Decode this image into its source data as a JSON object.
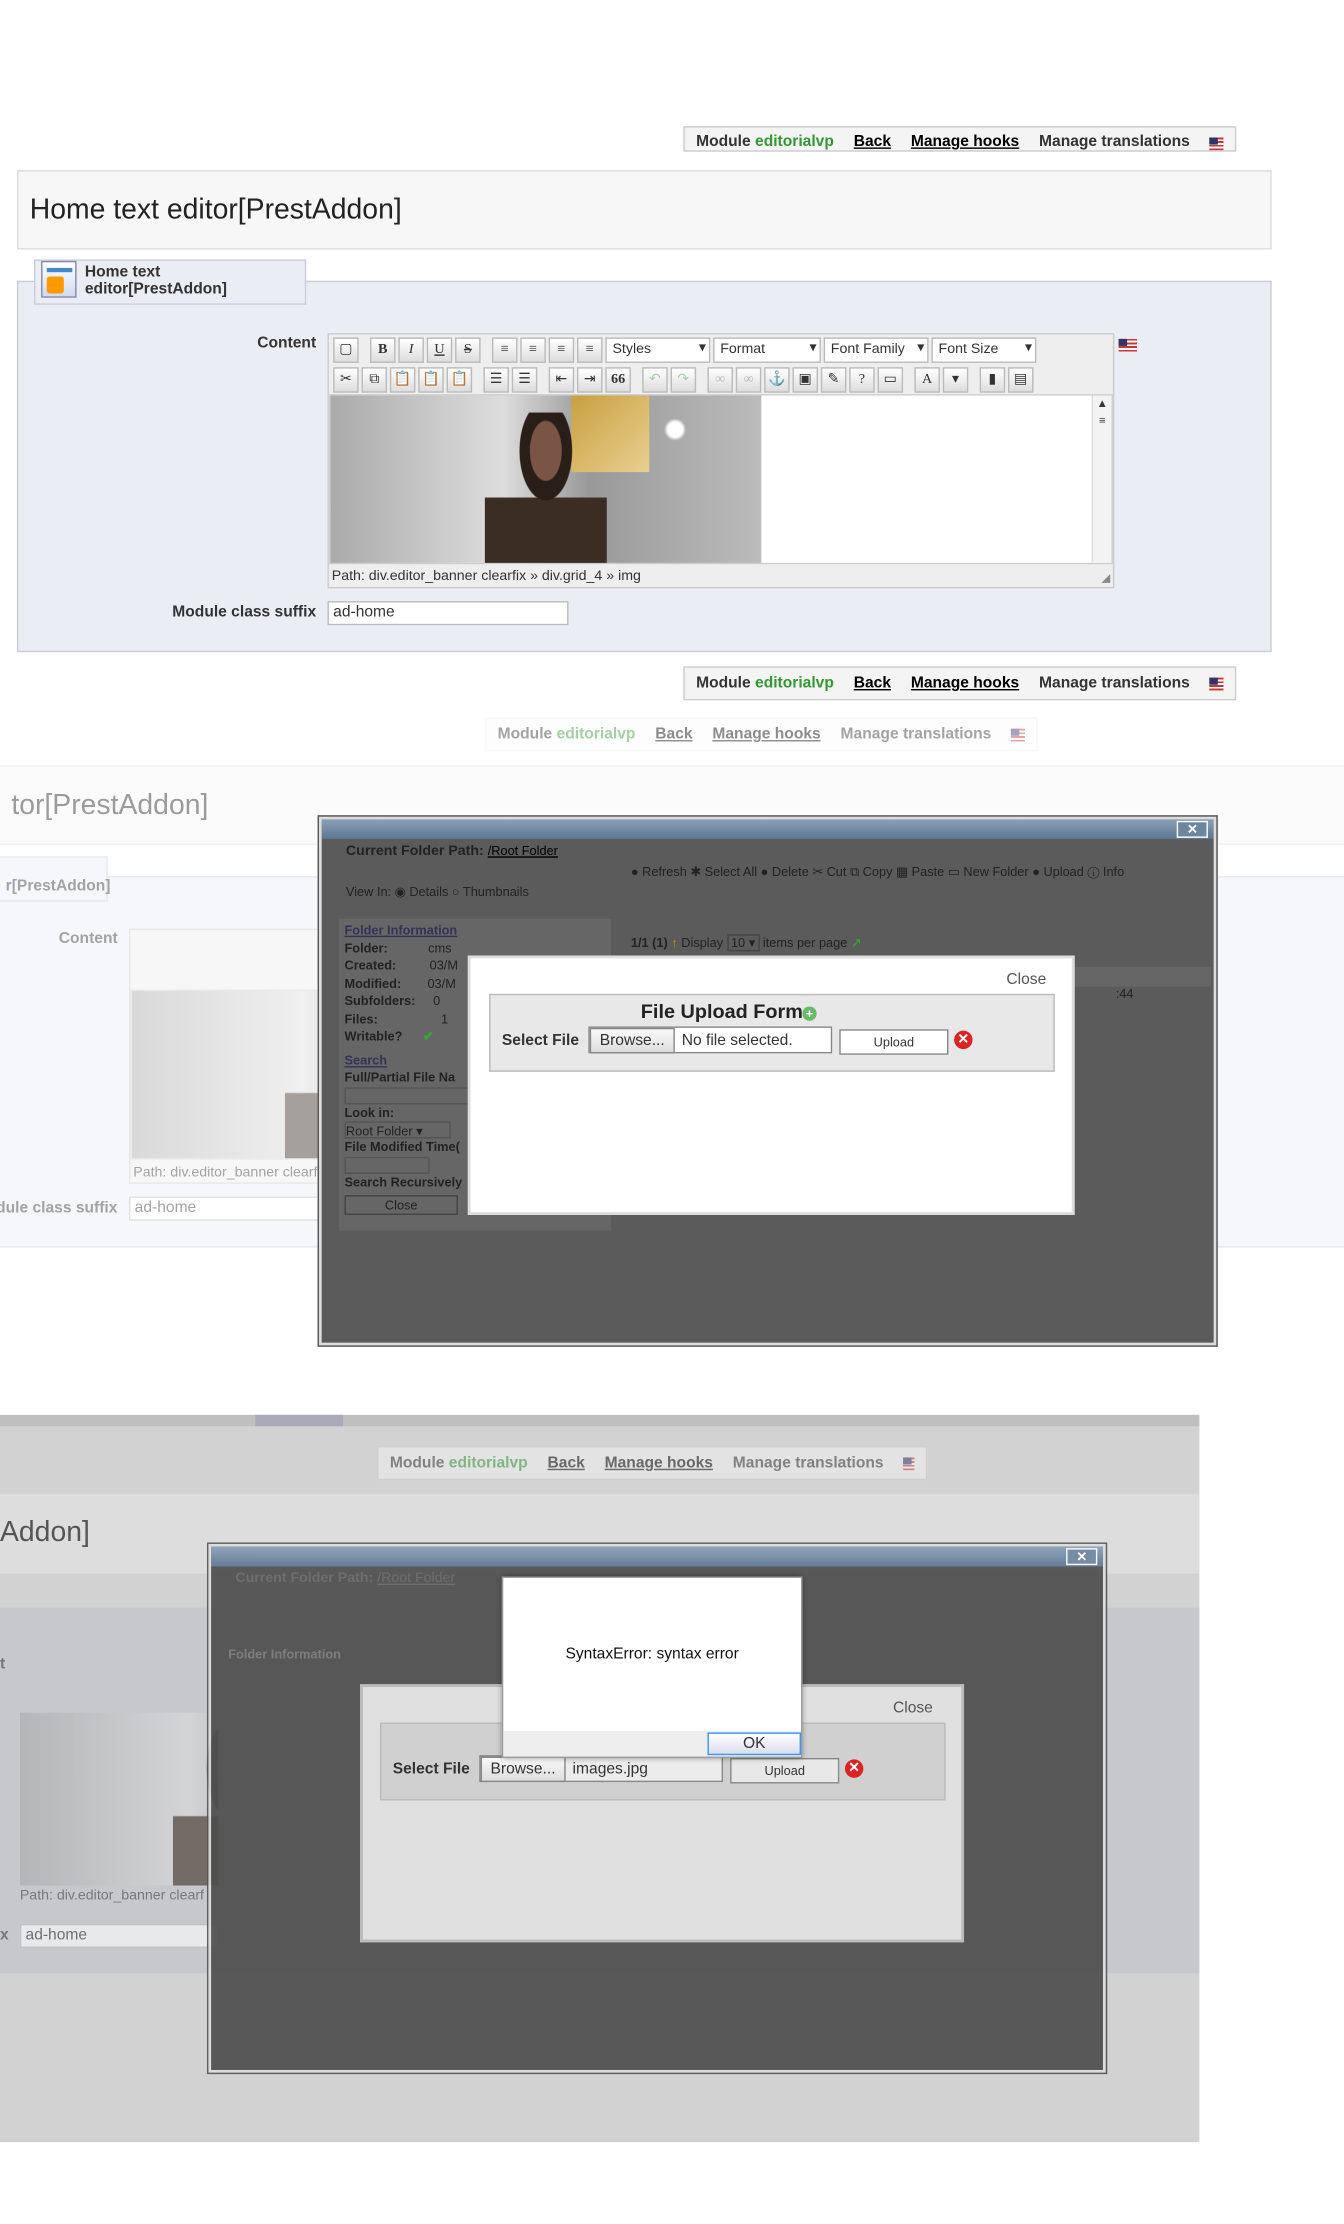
{
  "toolbar": {
    "module_label": "Module",
    "module_name": "editorialvp",
    "back": "Back",
    "manage_hooks": "Manage hooks",
    "manage_translations": "Manage translations"
  },
  "panel": {
    "title": "Home text editor[PrestAddon]",
    "legend": "Home text editor[PrestAddon]",
    "content_label": "Content",
    "class_suffix_label": "Module class suffix",
    "class_suffix_value": "ad-home",
    "path_text": "Path: div.editor_banner clearfix » div.grid_4 » img"
  },
  "editor": {
    "styles": "Styles",
    "format": "Format",
    "font_family": "Font Family",
    "font_size": "Font Size",
    "quote": "66"
  },
  "faded": {
    "title": "tor[PrestAddon]",
    "legend": "r[PrestAddon]",
    "content_label": "Content",
    "class_suffix_label": "odule class suffix",
    "class_suffix_value": "ad-home",
    "path_text": "Path: div.editor_banner clearf"
  },
  "filemanager": {
    "path_label": "Current Folder Path:",
    "root_link": "/Root Folder",
    "view_in": "View In:",
    "details": "Details",
    "thumbnails": "Thumbnails",
    "refresh": "Refresh",
    "select_all": "Select All",
    "delete": "Delete",
    "cut": "Cut",
    "copy": "Copy",
    "paste": "Paste",
    "new_folder": "New Folder",
    "upload": "Upload",
    "info": "Info",
    "folder_info": "Folder Information",
    "folder_k": "Folder:",
    "folder_v": "cms",
    "created_k": "Created:",
    "created_v": "03/M",
    "modified_k": "Modified:",
    "modified_v": "03/M",
    "subfolders_k": "Subfolders:",
    "subfolders_v": "0",
    "files_k": "Files:",
    "files_v": "1",
    "writable_k": "Writable?",
    "search": "Search",
    "full_partial": "Full/Partial File Na",
    "look_in": "Look in:",
    "root_folder": "Root Folder",
    "file_modified": "File Modified Time(",
    "search_recursively": "Search Recursively",
    "close": "Close",
    "page_count": "1/1 (1)",
    "display": "Display",
    "per_page_value": "10",
    "items_per_page": "items per page",
    "time_frag": ":44"
  },
  "upload_dialog": {
    "close": "Close",
    "title": "File Upload Form",
    "select_file": "Select File",
    "browse": "Browse...",
    "no_file": "No file selected.",
    "upload": "Upload",
    "file_value": "images.jpg"
  },
  "alert": {
    "message": "SyntaxError: syntax error",
    "ok": "OK"
  },
  "bg_fragment": {
    "title": "Addon]",
    "label_x": "x",
    "label_t": "t"
  }
}
